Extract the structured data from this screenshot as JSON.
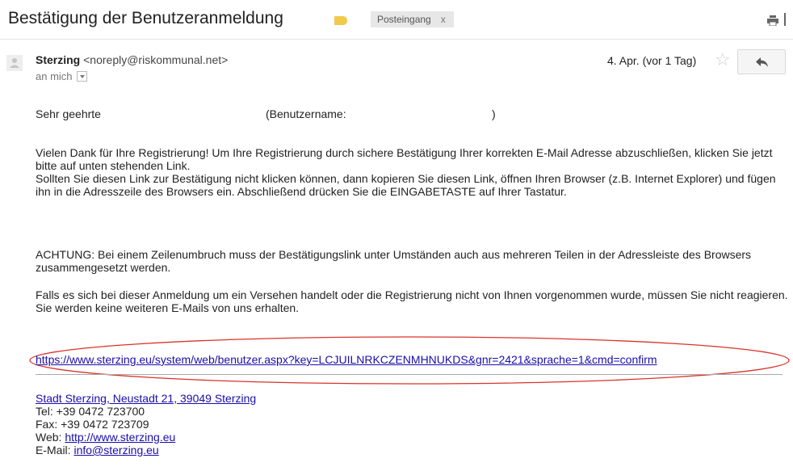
{
  "email": {
    "subject": "Bestätigung der Benutzeranmeldung",
    "label": "Posteingang",
    "label_remove": "x",
    "sender_name": "Sterzing",
    "sender_email": "<noreply@riskommunal.net>",
    "recipient": "an mich",
    "date": "4. Apr. (vor 1 Tag)"
  },
  "body": {
    "greeting_start": "Sehr geehrte",
    "greeting_user": "(Benutzername:",
    "greeting_end": ")",
    "paragraph1": "Vielen Dank für Ihre Registrierung! Um Ihre Registrierung durch sichere Bestätigung Ihrer korrekten E-Mail Adresse abzuschließen, klicken Sie jetzt bitte auf unten stehenden Link.",
    "paragraph1b": "Sollten Sie diesen Link zur Bestätigung nicht klicken können, dann kopieren Sie diesen Link, öffnen Ihren Browser (z.B. Internet Explorer) und fügen ihn in die Adresszeile des Browsers ein. Abschließend drücken Sie die EINGABETASTE auf Ihrer Tastatur.",
    "paragraph2": "ACHTUNG: Bei einem Zeilenumbruch muss der Bestätigungslink unter Umständen auch aus mehreren Teilen in der Adressleiste des Browsers zusammengesetzt werden.",
    "paragraph3": "Falls es sich bei dieser Anmeldung um ein Versehen handelt oder die Registrierung nicht von Ihnen vorgenommen wurde, müssen Sie nicht reagieren. Sie werden keine weiteren E-Mails von uns erhalten.",
    "confirm_link": "https://www.sterzing.eu/system/web/benutzer.aspx?key=LCJUILNRKCZENMHNUKDS&gnr=2421&sprache=1&cmd=confirm"
  },
  "signature": {
    "address": "Stadt Sterzing, Neustadt 21, 39049 Sterzing",
    "tel": "Tel: +39 0472 723700",
    "fax": "Fax: +39 0472 723709",
    "web_label": "Web:",
    "web_link": "http://www.sterzing.eu",
    "email_label": "E-Mail:",
    "email_link": "info@sterzing.eu"
  },
  "icons": {
    "important": "important-label-icon",
    "print": "print-icon",
    "star": "star-icon",
    "reply": "reply-arrow-icon",
    "avatar": "person-avatar-icon"
  },
  "colors": {
    "important": "#f2c94c",
    "link": "#1a0dab",
    "annotation": "#d9342b"
  }
}
